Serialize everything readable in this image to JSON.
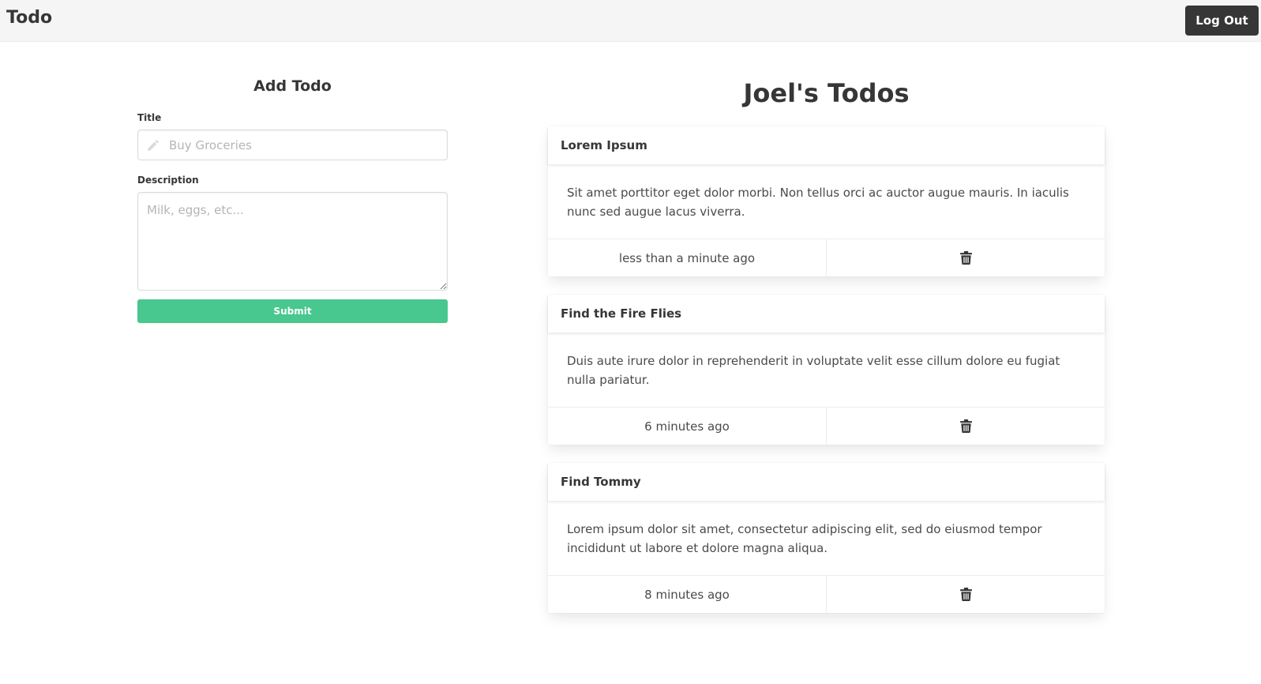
{
  "navbar": {
    "brand": "Todo",
    "logout_label": "Log Out"
  },
  "form": {
    "heading": "Add Todo",
    "title_label": "Title",
    "title_placeholder": "Buy Groceries",
    "title_icon": "pencil-icon",
    "description_label": "Description",
    "description_placeholder": "Milk, eggs, etc...",
    "submit_label": "Submit",
    "submit_color": "#48c78e"
  },
  "list": {
    "heading": "Joel's Todos",
    "todos": [
      {
        "title": "Lorem Ipsum",
        "description": "Sit amet porttitor eget dolor morbi. Non tellus orci ac auctor augue mauris. In iaculis nunc sed augue lacus viverra.",
        "time": "less than a minute ago",
        "delete_icon": "trash-icon"
      },
      {
        "title": "Find the Fire Flies",
        "description": "Duis aute irure dolor in reprehenderit in voluptate velit esse cillum dolore eu fugiat nulla pariatur.",
        "time": "6 minutes ago",
        "delete_icon": "trash-icon"
      },
      {
        "title": "Find Tommy",
        "description": "Lorem ipsum dolor sit amet, consectetur adipiscing elit, sed do eiusmod tempor incididunt ut labore et dolore magna aliqua.",
        "time": "8 minutes ago",
        "delete_icon": "trash-icon"
      }
    ]
  }
}
